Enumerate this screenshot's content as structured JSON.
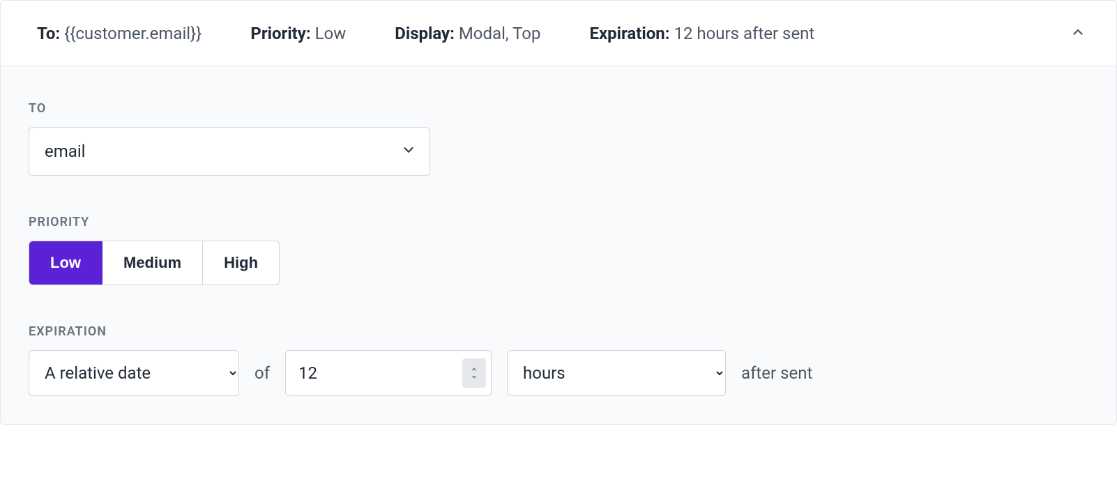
{
  "summary": {
    "to_label": "To:",
    "to_value": "{{customer.email}}",
    "priority_label": "Priority:",
    "priority_value": "Low",
    "display_label": "Display:",
    "display_value": "Modal, Top",
    "expiration_label": "Expiration:",
    "expiration_value": "12 hours after sent"
  },
  "sections": {
    "to": {
      "label": "TO",
      "selected": "email"
    },
    "priority": {
      "label": "PRIORITY",
      "options": {
        "low": "Low",
        "medium": "Medium",
        "high": "High"
      },
      "selected": "low"
    },
    "expiration": {
      "label": "EXPIRATION",
      "relative_option": "A relative date",
      "of_text": "of",
      "amount": "12",
      "unit": "hours",
      "suffix": "after sent"
    }
  }
}
